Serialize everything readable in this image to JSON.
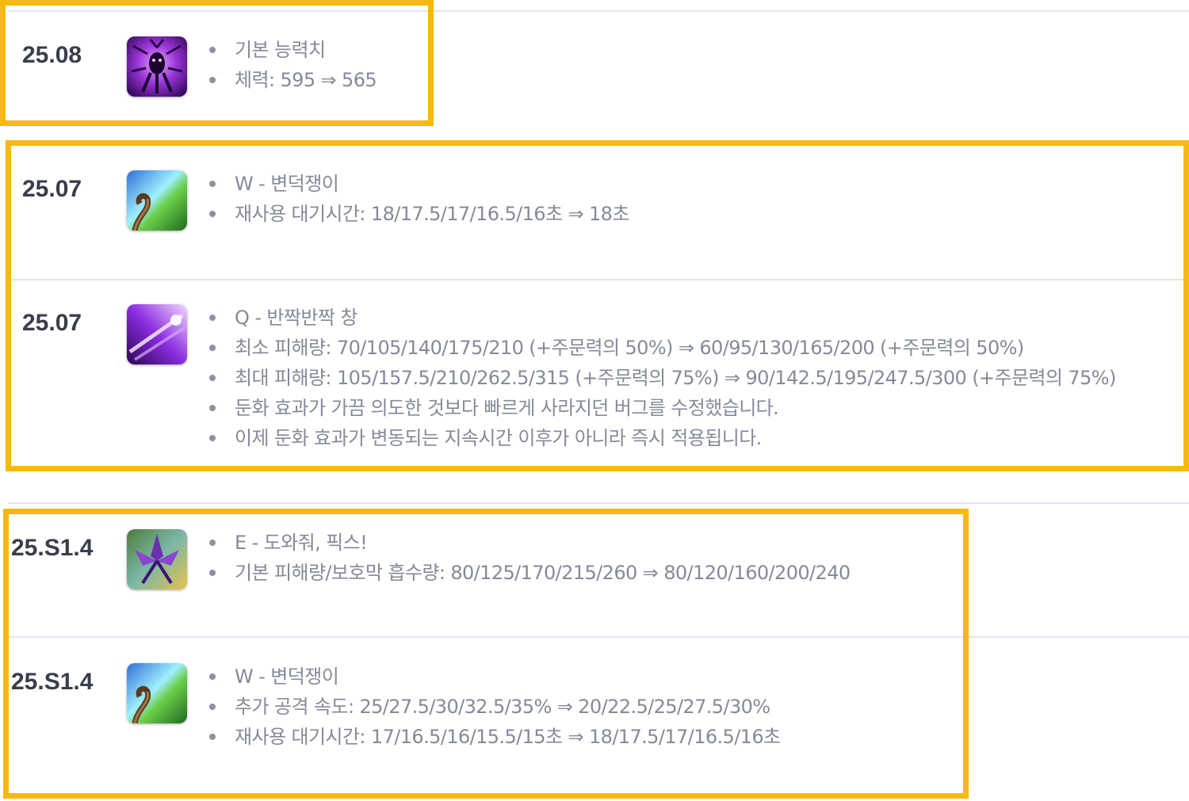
{
  "theme": {
    "highlight_color": "#f7b80f",
    "separator_color": "#dfe4f0",
    "version_color": "#3a3d4a",
    "note_color": "#858a99"
  },
  "entries": [
    {
      "version": "25.08",
      "icon": "champion-portrait-icon",
      "notes": [
        "기본 능력치",
        "체력: 595 ⇒ 565"
      ]
    },
    {
      "version": "25.07",
      "icon": "w-ability-icon",
      "notes": [
        "W - 변덕쟁이",
        "재사용 대기시간: 18/17.5/17/16.5/16초 ⇒ 18초"
      ]
    },
    {
      "version": "25.07",
      "icon": "q-ability-icon",
      "notes": [
        "Q - 반짝반짝 창",
        "최소 피해량: 70/105/140/175/210 (+주문력의 50%) ⇒ 60/95/130/165/200 (+주문력의 50%)",
        "최대 피해량: 105/157.5/210/262.5/315 (+주문력의 75%) ⇒ 90/142.5/195/247.5/300 (+주문력의 75%)",
        "둔화 효과가 가끔 의도한 것보다 빠르게 사라지던 버그를 수정했습니다.",
        "이제 둔화 효과가 변동되는 지속시간 이후가 아니라 즉시 적용됩니다."
      ]
    },
    {
      "version": "25.S1.4",
      "icon": "e-ability-icon",
      "notes": [
        "E - 도와줘, 픽스!",
        "기본 피해량/보호막 흡수량: 80/125/170/215/260 ⇒ 80/120/160/200/240"
      ]
    },
    {
      "version": "25.S1.4",
      "icon": "w-ability-icon",
      "notes": [
        "W - 변덕쟁이",
        "추가 공격 속도: 25/27.5/30/32.5/35% ⇒ 20/22.5/25/27.5/30%",
        "재사용 대기시간: 17/16.5/16/15.5/15초 ⇒ 18/17.5/17/16.5/16초"
      ]
    }
  ]
}
